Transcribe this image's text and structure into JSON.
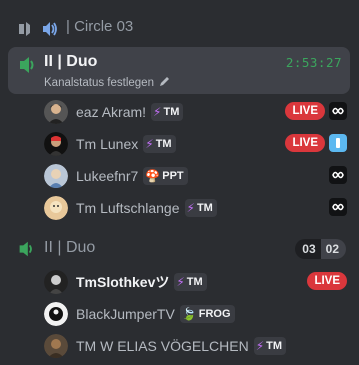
{
  "header": {
    "title": "| Circle 03"
  },
  "channel1": {
    "name": "II | Duo",
    "timer": "2:53:27",
    "status": "Kanalstatus festlegen",
    "users": [
      {
        "name": "eaz Akram!",
        "tag": {
          "icon": "⚡",
          "label": "TM",
          "color": "#c06ef5"
        },
        "live": "LIVE",
        "activity": "black"
      },
      {
        "name": "Tm Lunex",
        "tag": {
          "icon": "⚡",
          "label": "TM",
          "color": "#c06ef5"
        },
        "live": "LIVE",
        "activity": "blue"
      },
      {
        "name": "Lukeefnr7",
        "tag": {
          "icon": "🍄",
          "label": "PPT",
          "color": "#e04040"
        },
        "live": null,
        "activity": "black"
      },
      {
        "name": "Tm Luftschlange",
        "tag": {
          "icon": "⚡",
          "label": "TM",
          "color": "#c06ef5"
        },
        "live": null,
        "activity": "black"
      }
    ]
  },
  "channel2": {
    "name": "II | Duo",
    "count_current": "03",
    "count_limit": "02",
    "users": [
      {
        "name": "TmSlothkevツ",
        "tag": {
          "icon": "⚡",
          "label": "TM",
          "color": "#c06ef5"
        },
        "live": "LIVE"
      },
      {
        "name": "BlackJumperTV",
        "tag": {
          "icon": "🍃",
          "label": "FROG",
          "color": "#6ac045"
        },
        "live": null
      },
      {
        "name": "TM W ELIAS VÖGELCHEN",
        "tag": {
          "icon": "⚡",
          "label": "TM",
          "color": "#c06ef5"
        },
        "live": null
      }
    ]
  }
}
